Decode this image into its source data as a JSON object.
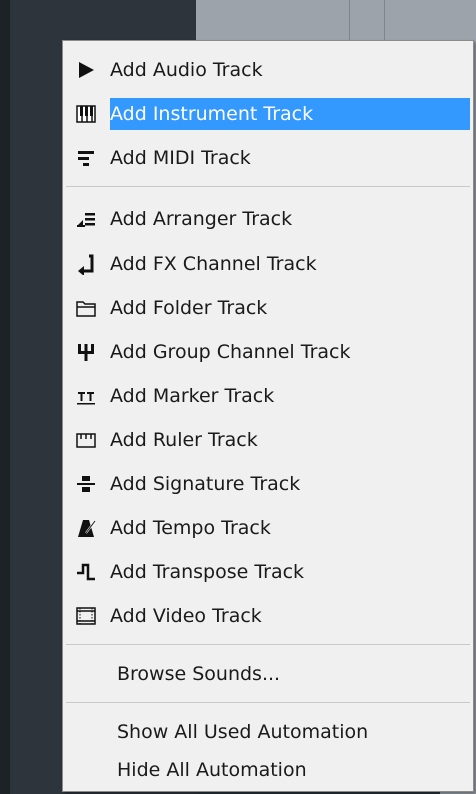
{
  "menu": {
    "items": [
      {
        "label": "Add Audio Track",
        "icon": "play-icon"
      },
      {
        "label": "Add Instrument Track",
        "icon": "piano-keys-icon",
        "selected": true
      },
      {
        "label": "Add MIDI Track",
        "icon": "midi-lines-icon"
      },
      {
        "label": "Add Arranger Track",
        "icon": "arranger-icon"
      },
      {
        "label": "Add FX Channel Track",
        "icon": "fx-return-icon"
      },
      {
        "label": "Add Folder Track",
        "icon": "folder-icon"
      },
      {
        "label": "Add Group Channel Track",
        "icon": "group-fork-icon"
      },
      {
        "label": "Add Marker Track",
        "icon": "marker-icon"
      },
      {
        "label": "Add Ruler Track",
        "icon": "ruler-icon"
      },
      {
        "label": "Add Signature Track",
        "icon": "signature-icon"
      },
      {
        "label": "Add Tempo Track",
        "icon": "metronome-icon"
      },
      {
        "label": "Add Transpose Track",
        "icon": "transpose-step-icon"
      },
      {
        "label": "Add Video Track",
        "icon": "film-icon"
      }
    ],
    "browse_label": "Browse Sounds...",
    "automation": [
      {
        "label": "Show All Used Automation"
      },
      {
        "label": "Hide All Automation"
      }
    ],
    "selection_color": "#3399ff"
  }
}
